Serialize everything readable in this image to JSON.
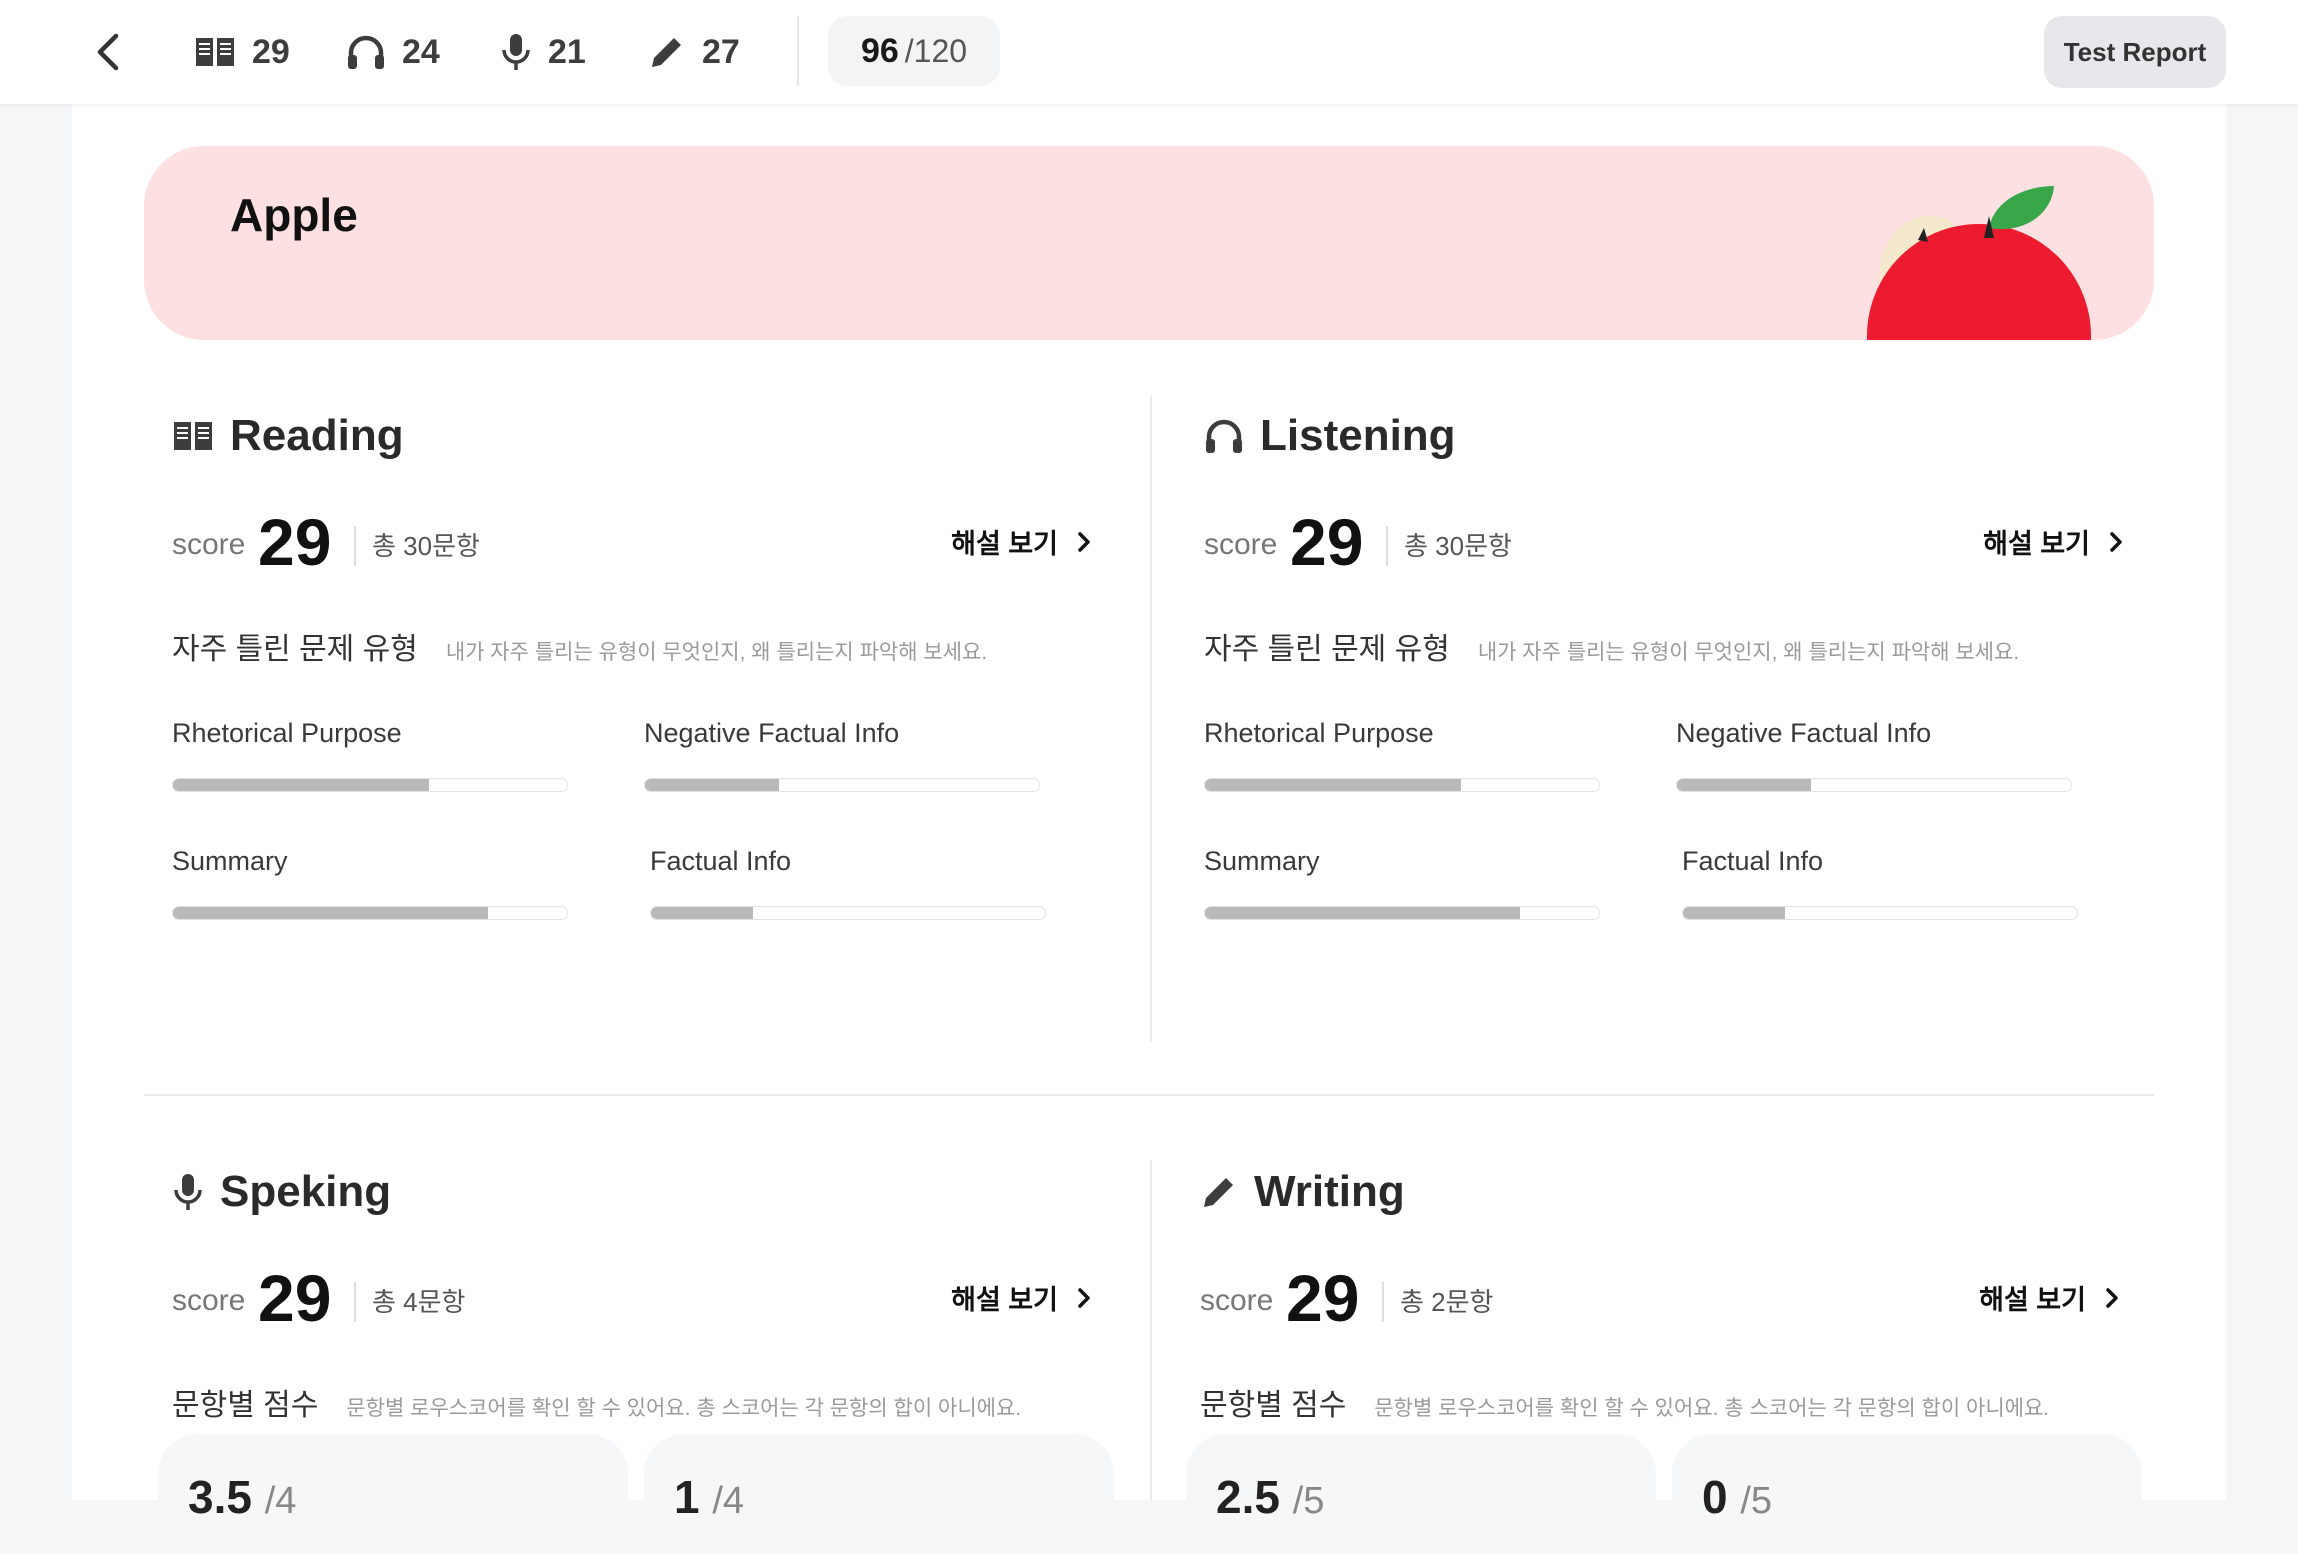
{
  "topbar": {
    "reading_count": "29",
    "listening_count": "24",
    "speaking_count": "21",
    "writing_count": "27",
    "total_score": "96",
    "total_max": "/120",
    "report_button": "Test Report"
  },
  "banner": {
    "title": "Apple"
  },
  "common": {
    "score_label": "score",
    "explain_label": "해설 보기"
  },
  "reading": {
    "title": "Reading",
    "score": "29",
    "count": "총 30문항",
    "sub_title": "자주 틀린 문제 유형",
    "sub_desc": "내가 자주 틀리는 유형이 무엇인지, 왜 틀리는지 파악해 보세요.",
    "categories": [
      {
        "label": "Rhetorical Purpose",
        "progress": 0.65
      },
      {
        "label": "Negative Factual Info",
        "progress": 0.34
      },
      {
        "label": "Summary",
        "progress": 0.8
      },
      {
        "label": "Factual Info",
        "progress": 0.26
      }
    ]
  },
  "listening": {
    "title": "Listening",
    "score": "29",
    "count": "총 30문항",
    "sub_title": "자주 틀린 문제 유형",
    "sub_desc": "내가 자주 틀리는 유형이 무엇인지, 왜 틀리는지 파악해 보세요.",
    "categories": [
      {
        "label": "Rhetorical Purpose",
        "progress": 0.65
      },
      {
        "label": "Negative Factual Info",
        "progress": 0.34
      },
      {
        "label": "Summary",
        "progress": 0.8
      },
      {
        "label": "Factual Info",
        "progress": 0.26
      }
    ]
  },
  "speaking": {
    "title": "Speking",
    "score": "29",
    "count": "총 4문항",
    "sub_title": "문항별 점수",
    "sub_desc": "문항별 로우스코어를 확인 할 수 있어요. 총 스코어는 각 문항의 합이 아니에요.",
    "questions": [
      {
        "value": "3.5",
        "max": "/4"
      },
      {
        "value": "1",
        "max": "/4"
      }
    ]
  },
  "writing": {
    "title": "Writing",
    "score": "29",
    "count": "총 2문항",
    "sub_title": "문항별 점수",
    "sub_desc": "문항별 로우스코어를 확인 할 수 있어요. 총 스코어는 각 문항의 합이 아니에요.",
    "questions": [
      {
        "value": "2.5",
        "max": "/5"
      },
      {
        "value": "0",
        "max": "/5"
      }
    ]
  },
  "colors": {
    "banner_bg": "#fde0e2",
    "apple_red": "#ec1b30",
    "leaf_green": "#3aa64a",
    "progress_fill": "#b9b9b9"
  }
}
